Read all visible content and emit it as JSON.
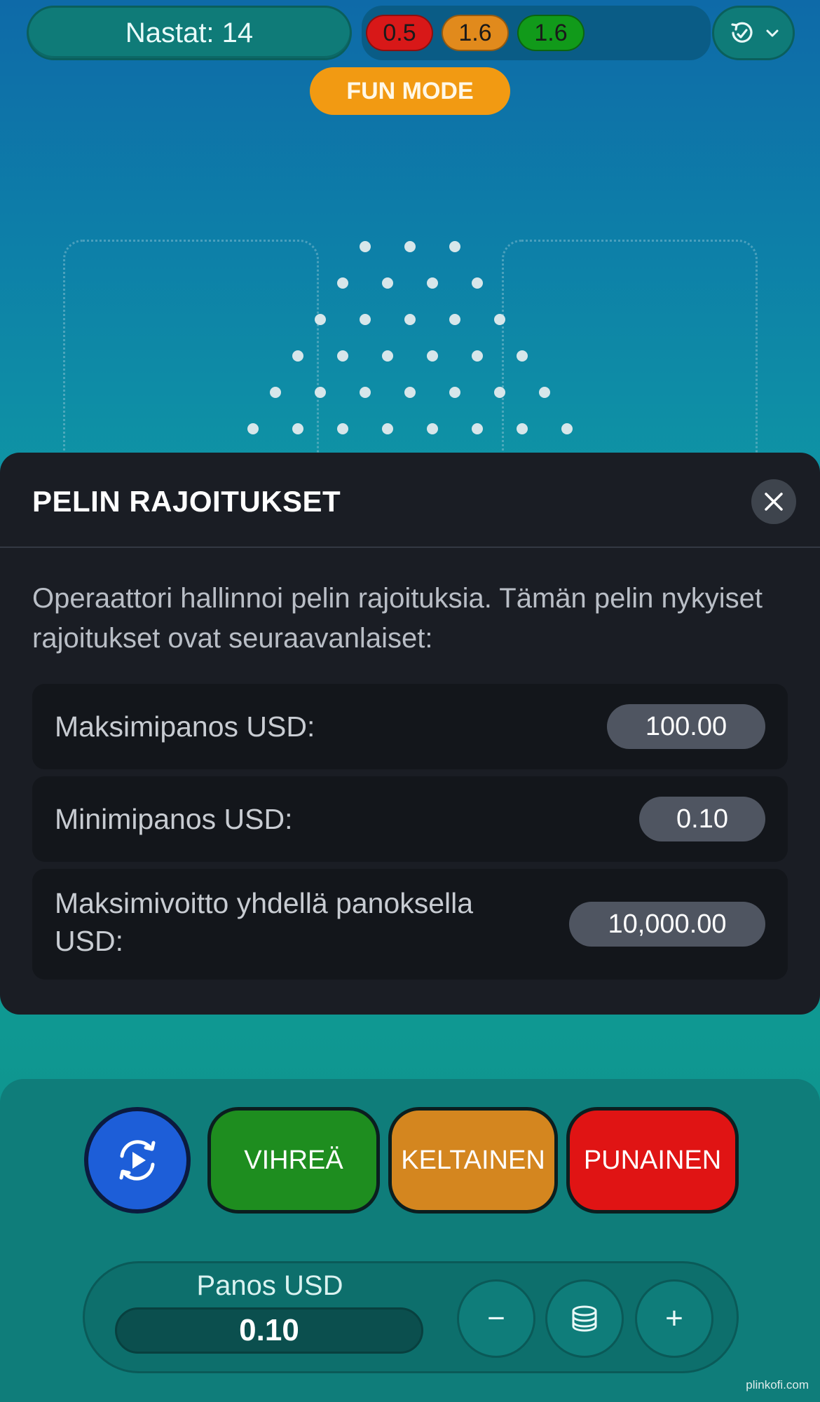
{
  "header": {
    "pins_label": "Nastat: 14",
    "multipliers": [
      {
        "value": "0.5",
        "color": "#d81818"
      },
      {
        "value": "1.6",
        "color": "#e18a1c"
      },
      {
        "value": "1.6",
        "color": "#119a1a"
      }
    ],
    "fun_mode_label": "FUN MODE"
  },
  "modal": {
    "title": "PELIN RAJOITUKSET",
    "description": "Operaattori hallinnoi pelin rajoituksia. Tämän pelin nykyiset rajoitukset ovat seuraavanlaiset:",
    "limits": [
      {
        "label": "Maksimipanos USD:",
        "value": "100.00"
      },
      {
        "label": "Minimipanos USD:",
        "value": "0.10"
      },
      {
        "label": "Maksimivoitto yhdellä panoksella USD:",
        "value": "10,000.00"
      }
    ]
  },
  "controls": {
    "green_label": "VIHREÄ",
    "yellow_label": "KELTAINEN",
    "red_label": "PUNAINEN",
    "bet_label": "Panos USD",
    "bet_value": "0.10",
    "minus_label": "−",
    "plus_label": "+"
  },
  "watermark": "plinkofi.com",
  "colors": {
    "green_button": "#1e8d1f",
    "yellow_button": "#d4861f",
    "red_button": "#e01414",
    "autoplay_button": "#1d5ed8",
    "fun_mode": "#f29a12"
  }
}
